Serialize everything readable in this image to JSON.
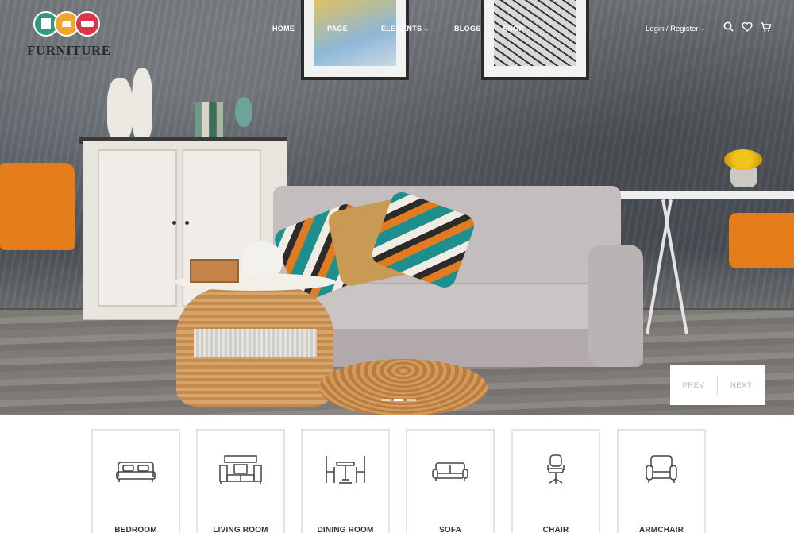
{
  "brand": {
    "name": "FURNITURE",
    "tagline": "TAGLINE HERE",
    "colors": {
      "green": "#2e9b7e",
      "orange": "#f1a52a",
      "red": "#d9364b"
    }
  },
  "nav": {
    "items": [
      {
        "label": "HOME"
      },
      {
        "label": "PAGE"
      },
      {
        "label": "ELEMENTS",
        "has_dropdown": true
      },
      {
        "label": "BLOGS"
      },
      {
        "label": "SHOP"
      }
    ],
    "login_label": "Login / Register",
    "icons": [
      "search-icon",
      "heart-icon",
      "cart-icon"
    ]
  },
  "hero": {
    "prev_label": "PREV",
    "next_label": "NEXT",
    "slide_count": 3,
    "active_slide": 2
  },
  "categories": [
    {
      "label": "BEDROOM",
      "icon": "bed-icon"
    },
    {
      "label": "LIVING ROOM",
      "icon": "tv-unit-icon"
    },
    {
      "label": "DINING ROOM",
      "icon": "dining-set-icon"
    },
    {
      "label": "SOFA",
      "icon": "sofa-icon"
    },
    {
      "label": "CHAIR",
      "icon": "office-chair-icon"
    },
    {
      "label": "ARMCHAIR",
      "icon": "armchair-icon"
    }
  ]
}
